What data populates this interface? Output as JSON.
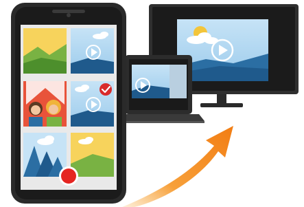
{
  "illustration": {
    "subject": "phone-media-casting-to-laptop-and-tv",
    "colors": {
      "background": "#ffffff",
      "device_body": "#2b2b2b",
      "device_bezel": "#1a1a1a",
      "screen_bg": "#e9e9e9",
      "sky": "#a9d3f0",
      "mountain_blue": "#1f5a8c",
      "grass_green": "#79b243",
      "sun_yellow": "#f3c53a",
      "record_red": "#e52521",
      "check_red": "#d92b2b",
      "arrow_orange": "#f58a1f",
      "play_white": "#ffffff"
    },
    "icons": [
      "play-icon",
      "check-badge-icon",
      "record-button-icon",
      "cast-arrow-icon"
    ]
  }
}
